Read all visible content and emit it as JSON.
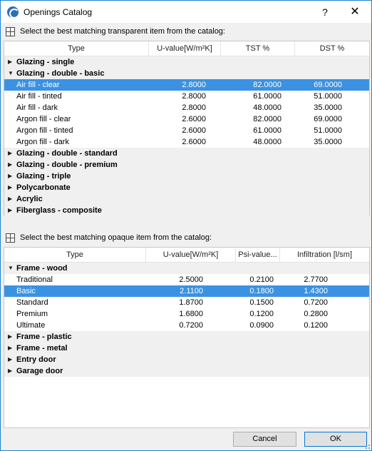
{
  "window": {
    "title": "Openings Catalog",
    "help_glyph": "?",
    "close_glyph": "✕"
  },
  "transparent": {
    "heading": "Select the best matching transparent item from the catalog:",
    "columns": [
      "Type",
      "U-value[W/m²K]",
      "TST %",
      "DST %"
    ],
    "rows": [
      {
        "kind": "group",
        "expanded": false,
        "label": "Glazing - single"
      },
      {
        "kind": "group",
        "expanded": true,
        "label": "Glazing - double - basic"
      },
      {
        "kind": "item",
        "selected": true,
        "cells": [
          "Air fill - clear",
          "2.8000",
          "82.0000",
          "69.0000"
        ]
      },
      {
        "kind": "item",
        "selected": false,
        "cells": [
          "Air fill - tinted",
          "2.8000",
          "61.0000",
          "51.0000"
        ]
      },
      {
        "kind": "item",
        "selected": false,
        "cells": [
          "Air fill - dark",
          "2.8000",
          "48.0000",
          "35.0000"
        ]
      },
      {
        "kind": "item",
        "selected": false,
        "cells": [
          "Argon fill - clear",
          "2.6000",
          "82.0000",
          "69.0000"
        ]
      },
      {
        "kind": "item",
        "selected": false,
        "cells": [
          "Argon fill - tinted",
          "2.6000",
          "61.0000",
          "51.0000"
        ]
      },
      {
        "kind": "item",
        "selected": false,
        "cells": [
          "Argon fill - dark",
          "2.6000",
          "48.0000",
          "35.0000"
        ]
      },
      {
        "kind": "group",
        "expanded": false,
        "label": "Glazing - double - standard"
      },
      {
        "kind": "group",
        "expanded": false,
        "label": "Glazing - double - premium"
      },
      {
        "kind": "group",
        "expanded": false,
        "label": "Glazing - triple"
      },
      {
        "kind": "group",
        "expanded": false,
        "label": "Polycarbonate"
      },
      {
        "kind": "group",
        "expanded": false,
        "label": "Acrylic"
      },
      {
        "kind": "group",
        "expanded": false,
        "label": "Fiberglass - composite"
      }
    ]
  },
  "opaque": {
    "heading": "Select the best matching opaque item from the catalog:",
    "columns": [
      "Type",
      "U-value[W/m²K]",
      "Psi-value...",
      "Infiltration [l/sm]"
    ],
    "rows": [
      {
        "kind": "group",
        "expanded": true,
        "label": "Frame - wood"
      },
      {
        "kind": "item",
        "selected": false,
        "cells": [
          "Traditional",
          "2.5000",
          "0.2100",
          "2.7700"
        ]
      },
      {
        "kind": "item",
        "selected": true,
        "cells": [
          "Basic",
          "2.1100",
          "0.1800",
          "1.4300"
        ]
      },
      {
        "kind": "item",
        "selected": false,
        "cells": [
          "Standard",
          "1.8700",
          "0.1500",
          "0.7200"
        ]
      },
      {
        "kind": "item",
        "selected": false,
        "cells": [
          "Premium",
          "1.6800",
          "0.1200",
          "0.2800"
        ]
      },
      {
        "kind": "item",
        "selected": false,
        "cells": [
          "Ultimate",
          "0.7200",
          "0.0900",
          "0.1200"
        ]
      },
      {
        "kind": "group",
        "expanded": false,
        "label": "Frame - plastic"
      },
      {
        "kind": "group",
        "expanded": false,
        "label": "Frame - metal"
      },
      {
        "kind": "group",
        "expanded": false,
        "label": "Entry door"
      },
      {
        "kind": "group",
        "expanded": false,
        "label": "Garage door"
      }
    ]
  },
  "buttons": {
    "cancel": "Cancel",
    "ok": "OK"
  },
  "colors": {
    "selection": "#3b92e2",
    "group_row": "#f0f0f0",
    "window_border": "#1883d7"
  }
}
